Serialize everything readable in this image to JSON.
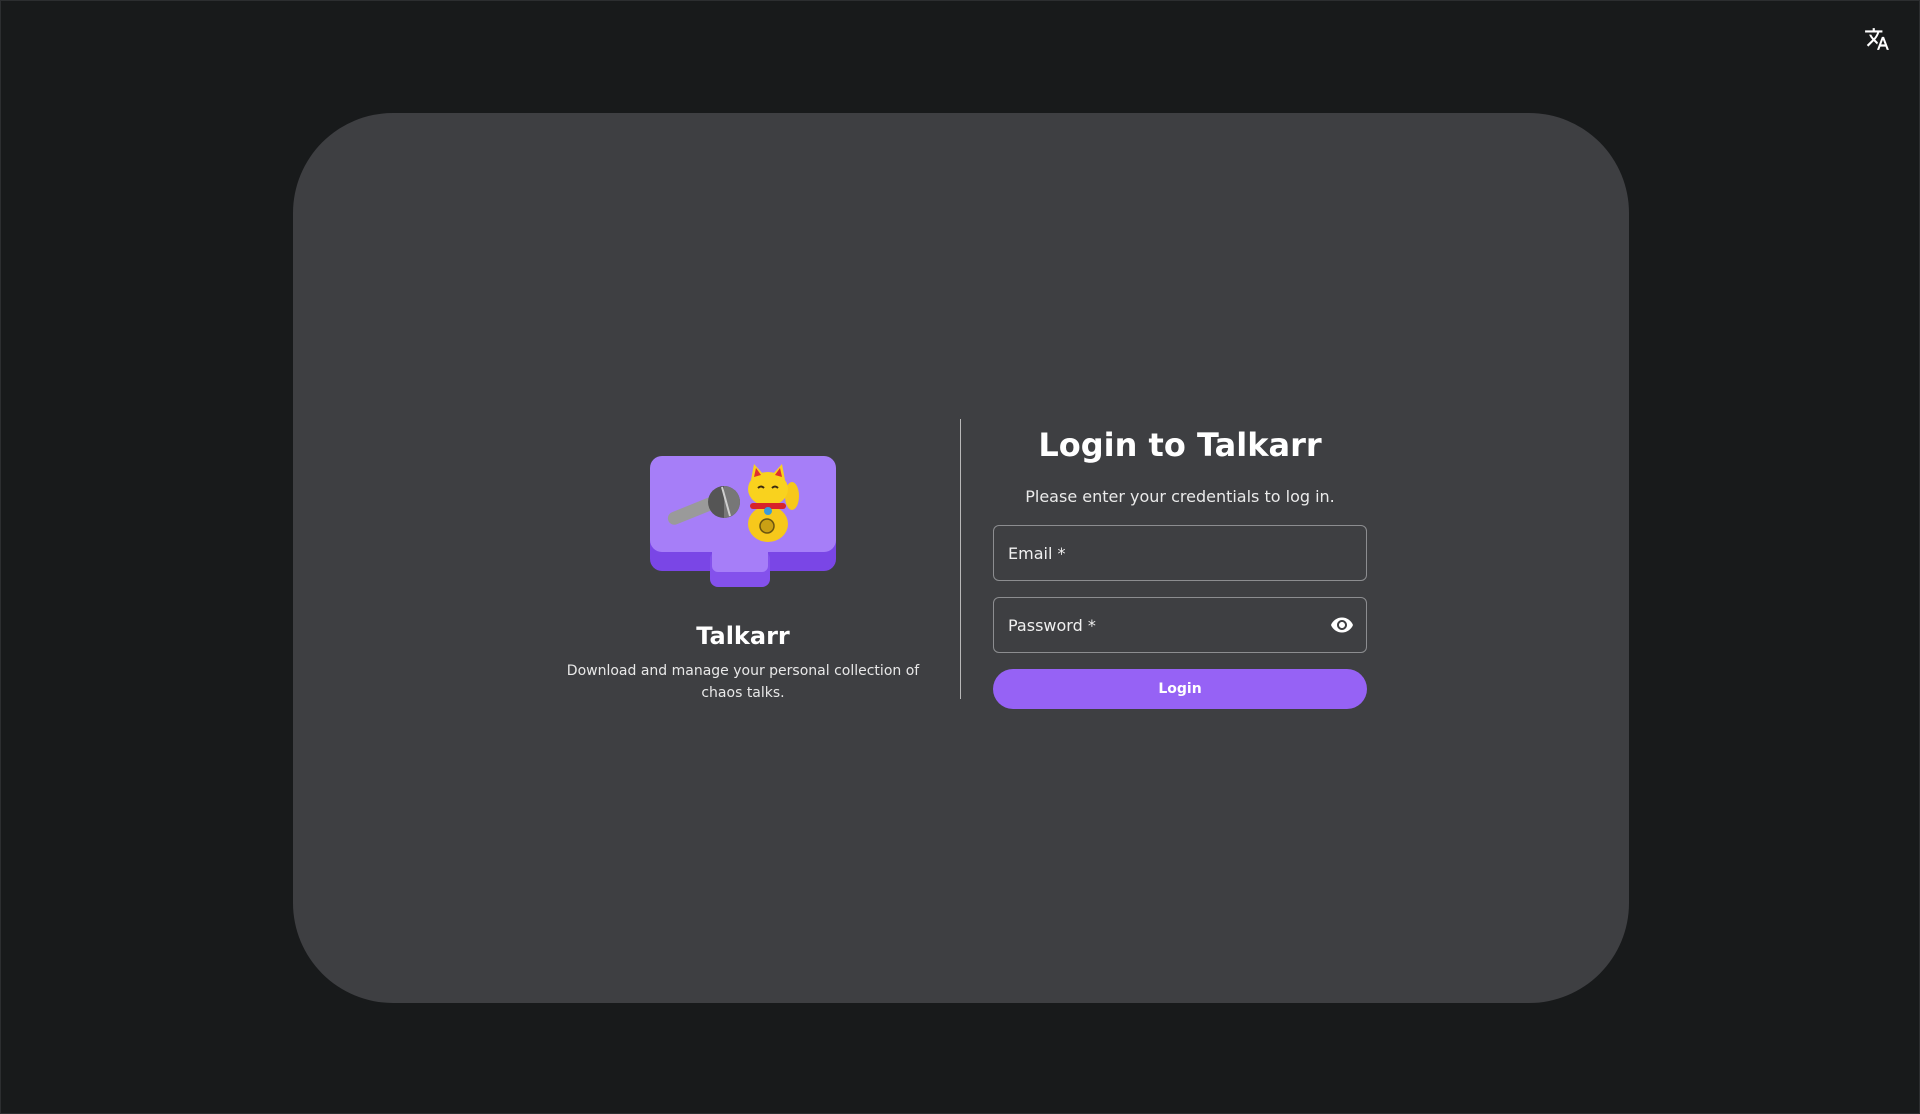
{
  "header": {
    "language_icon": "translate-icon"
  },
  "brand": {
    "logo_icon": "talkarr-logo-icon",
    "name": "Talkarr",
    "description": "Download and manage your personal collection of chaos talks."
  },
  "login": {
    "title": "Login to Talkarr",
    "subtitle": "Please enter your credentials to log in.",
    "email_placeholder": "Email *",
    "email_value": "",
    "password_placeholder": "Password *",
    "password_value": "",
    "password_toggle_icon": "eye-icon",
    "submit_label": "Login"
  },
  "colors": {
    "background": "#181a1b",
    "card": "#3e3f42",
    "accent": "#9662f5"
  }
}
